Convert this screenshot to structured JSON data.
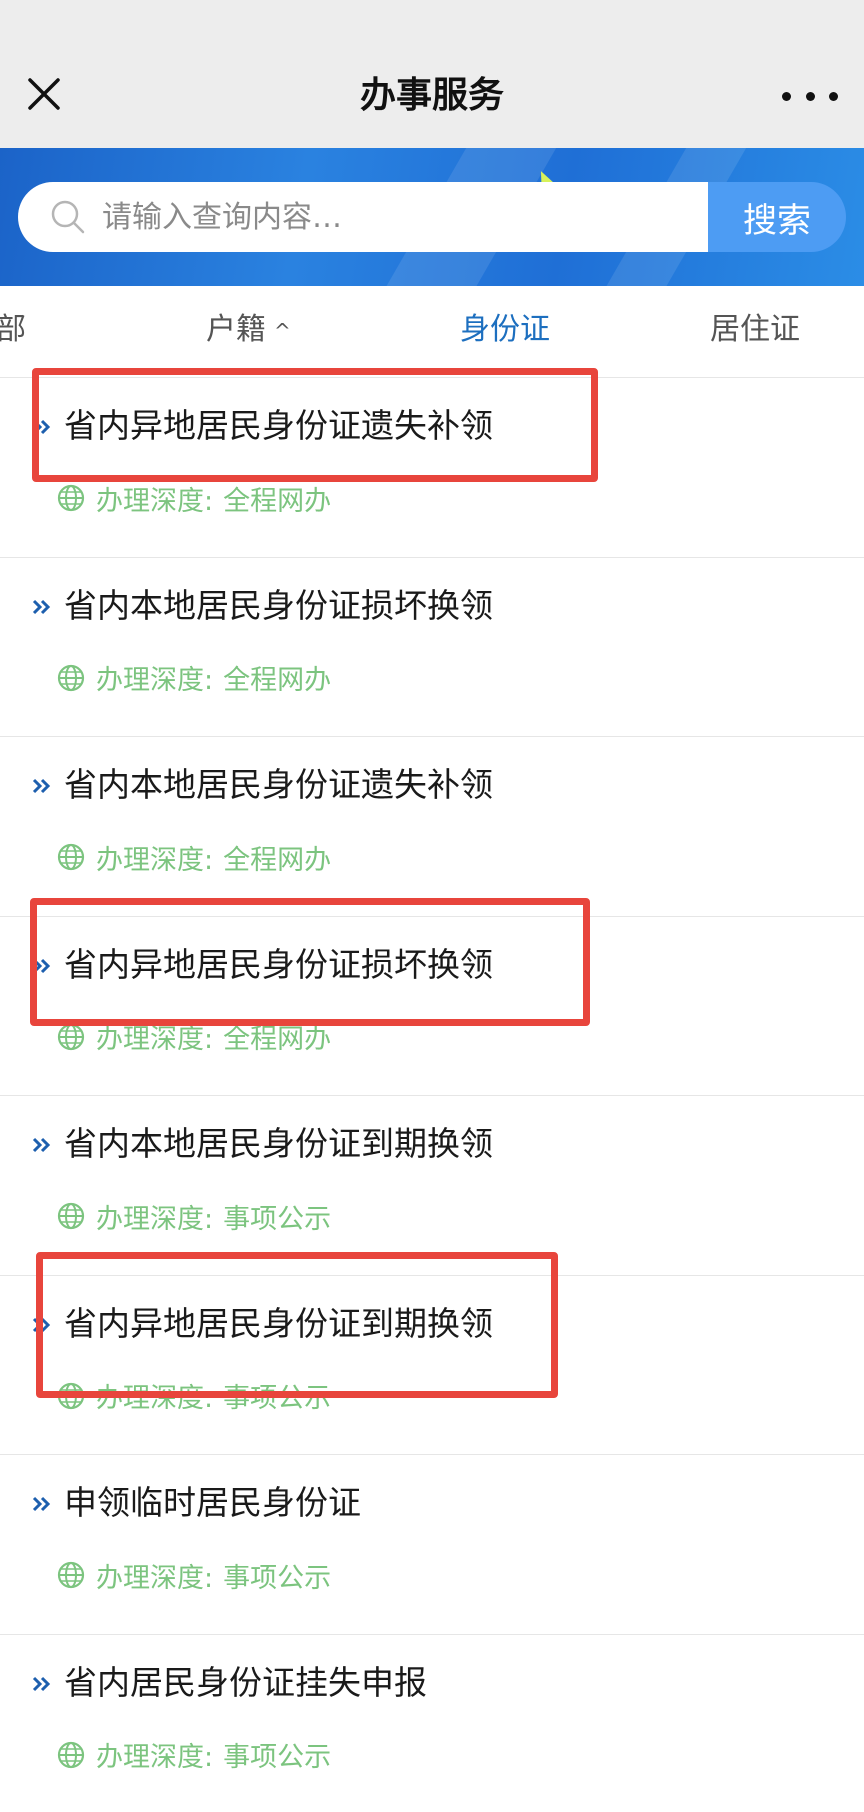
{
  "header": {
    "title": "办事服务",
    "close_icon": "close-icon",
    "more_icon": "more-dots-icon"
  },
  "search": {
    "placeholder": "请输入查询内容…",
    "button_label": "搜索",
    "icon": "search-icon"
  },
  "tabs": [
    {
      "label": "全部",
      "visible_text": "部",
      "active": false
    },
    {
      "label": "户籍",
      "active": false,
      "has_chevron": true,
      "chevron": "^"
    },
    {
      "label": "身份证",
      "active": true
    },
    {
      "label": "居住证",
      "active": false
    }
  ],
  "items": [
    {
      "title": "省内异地居民身份证遗失补领",
      "meta_label": "办理深度:",
      "meta_value": "全程网办",
      "highlighted": true
    },
    {
      "title": "省内本地居民身份证损坏换领",
      "meta_label": "办理深度:",
      "meta_value": "全程网办",
      "highlighted": false
    },
    {
      "title": "省内本地居民身份证遗失补领",
      "meta_label": "办理深度:",
      "meta_value": "全程网办",
      "highlighted": false
    },
    {
      "title": "省内异地居民身份证损坏换领",
      "meta_label": "办理深度:",
      "meta_value": "全程网办",
      "highlighted": true
    },
    {
      "title": "省内本地居民身份证到期换领",
      "meta_label": "办理深度:",
      "meta_value": "事项公示",
      "highlighted": false
    },
    {
      "title": "省内异地居民身份证到期换领",
      "meta_label": "办理深度:",
      "meta_value": "事项公示",
      "highlighted": true
    },
    {
      "title": "申领临时居民身份证",
      "meta_label": "办理深度:",
      "meta_value": "事项公示",
      "highlighted": false
    },
    {
      "title": "省内居民身份证挂失申报",
      "meta_label": "办理深度:",
      "meta_value": "事项公示",
      "highlighted": false
    }
  ],
  "colors": {
    "accent_tab": "#1d6fbf",
    "banner_blue": "#1f6fd6",
    "search_button": "#4d9cf3",
    "meta_green": "#7cc47f",
    "highlight_red": "#e8453c"
  }
}
